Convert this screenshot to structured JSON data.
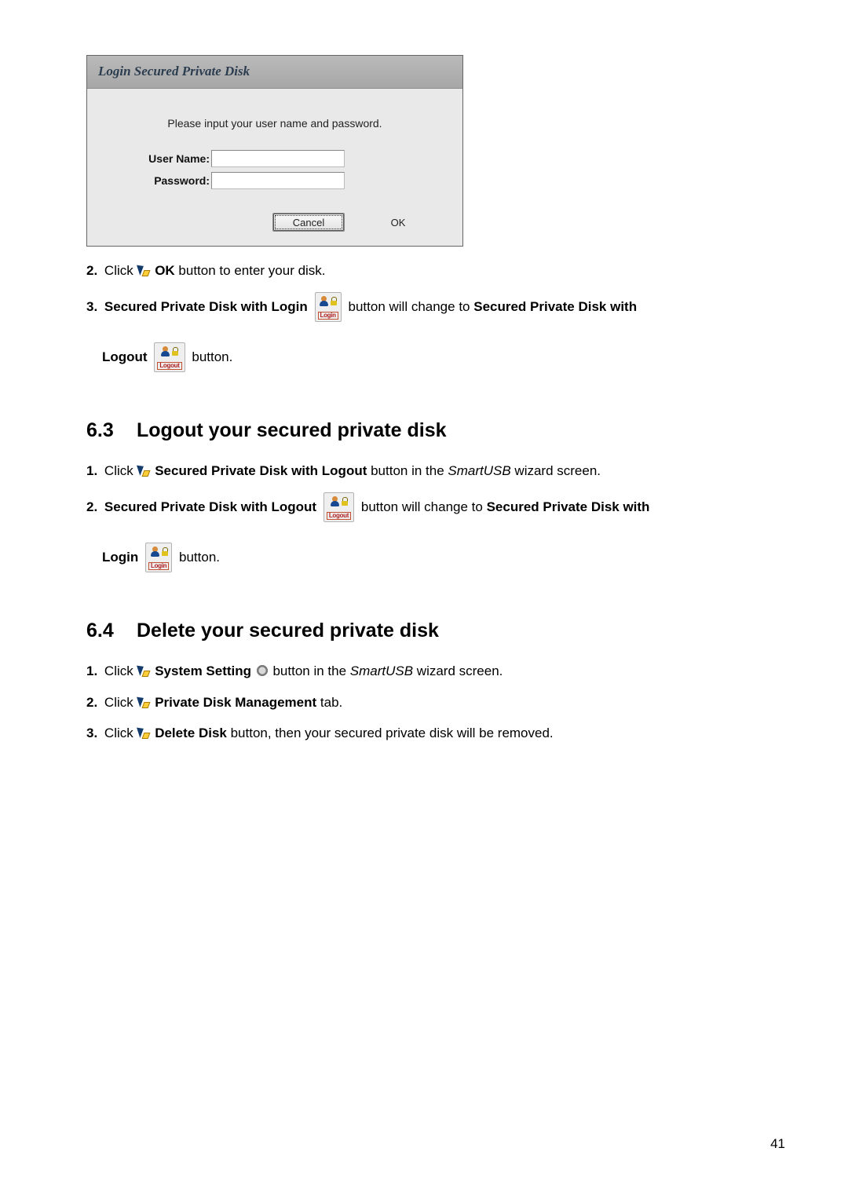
{
  "dialog": {
    "title": "Login Secured Private Disk",
    "message": "Please input your user name and password.",
    "username_label": "User Name:",
    "password_label": "Password:",
    "username_value": "",
    "password_value": "",
    "cancel": "Cancel",
    "ok": "OK"
  },
  "steps_top": {
    "s2_prefix": "2.",
    "s2_a": " Click ",
    "s2_b": "OK",
    "s2_c": " button to enter your disk.",
    "s3_prefix": "3.",
    "s3_a": " Secured Private Disk with Login",
    "s3_b": " button will change to ",
    "s3_c": "Secured Private Disk with",
    "s3_d": "Logout",
    "s3_e": " button."
  },
  "icons": {
    "login_label": "Login",
    "logout_label": "Logout"
  },
  "section_6_3": {
    "num": "6.3",
    "title": "Logout your secured private disk",
    "s1_prefix": "1.",
    "s1_a": " Click ",
    "s1_b": "Secured Private Disk with Logout",
    "s1_c": " button in the ",
    "s1_d": "SmartUSB",
    "s1_e": " wizard screen.",
    "s2_prefix": "2.",
    "s2_a": " Secured Private Disk with Logout",
    "s2_b": " button will change to ",
    "s2_c": "Secured Private Disk with",
    "s2_d": "Login",
    "s2_e": " button."
  },
  "section_6_4": {
    "num": "6.4",
    "title": "Delete your secured private disk",
    "s1_prefix": "1.",
    "s1_a": " Click ",
    "s1_b": "System Setting",
    "s1_c": " button in the ",
    "s1_d": "SmartUSB",
    "s1_e": " wizard screen.",
    "s2_prefix": "2.",
    "s2_a": " Click ",
    "s2_b": "Private Disk Management",
    "s2_c": " tab.",
    "s3_prefix": "3.",
    "s3_a": " Click ",
    "s3_b": "Delete Disk",
    "s3_c": " button, then your secured private disk will be removed."
  },
  "page_number": "41"
}
